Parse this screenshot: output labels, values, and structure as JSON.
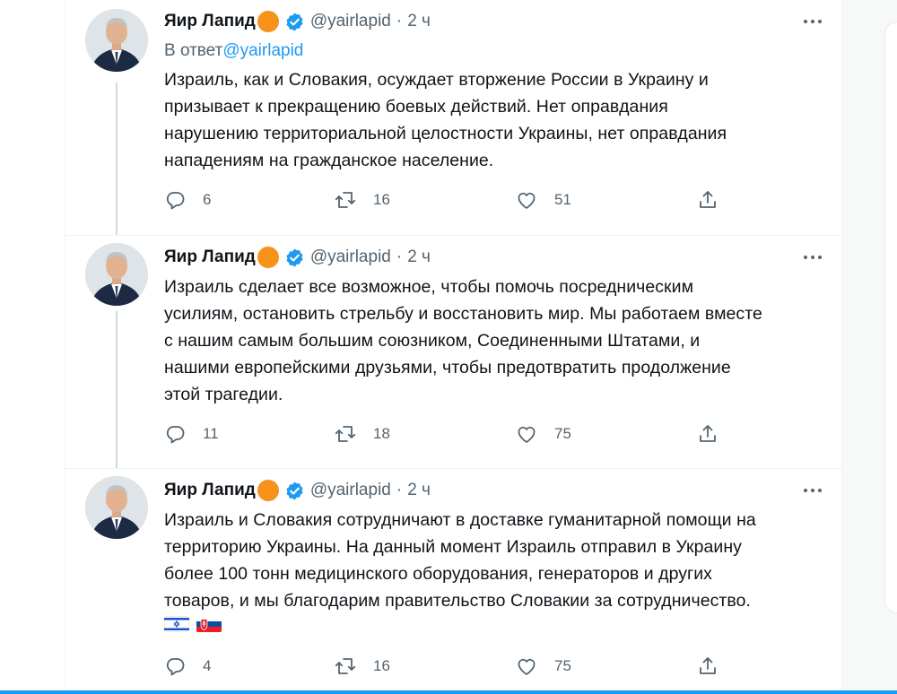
{
  "tweets": [
    {
      "author_name": "Яир Лапид",
      "handle": "@yairlapid",
      "separator": "·",
      "time": "2 ч",
      "reply_prefix": "В ответ",
      "reply_handle": "@yairlapid",
      "text_lines": [
        "Израиль, как и Словакия, осуждает вторжение России в Украину и",
        "призывает к прекращению боевых действий. Нет оправдания",
        "нарушению территориальной целостности Украины, нет оправдания",
        "нападениям на гражданское население."
      ],
      "replies": "6",
      "retweets": "16",
      "likes": "51"
    },
    {
      "author_name": "Яир Лапид",
      "handle": "@yairlapid",
      "separator": "·",
      "time": "2 ч",
      "text_lines": [
        "Израиль сделает все возможное, чтобы помочь посредническим",
        "усилиям, остановить стрельбу и восстановить мир. Мы работаем вместе",
        "с нашим самым большим союзником, Соединенными Штатами, и",
        "нашими европейскими друзьями, чтобы предотвратить продолжение",
        "этой трагедии."
      ],
      "replies": "11",
      "retweets": "18",
      "likes": "75"
    },
    {
      "author_name": "Яир Лапид",
      "handle": "@yairlapid",
      "separator": "·",
      "time": "2 ч",
      "text_lines": [
        "Израиль и Словакия сотрудничают в доставке гуманитарной помощи на",
        "территорию Украины. На данный момент Израиль отправил в Украину",
        "более 100 тонн медицинского оборудования, генераторов и других",
        "товаров, и мы благодарим правительство Словакии за сотрудничество."
      ],
      "flags": [
        "israel-flag",
        "slovakia-flag"
      ],
      "replies": "4",
      "retweets": "16",
      "likes": "75"
    }
  ],
  "colors": {
    "accent": "#1d9bf0",
    "secondary_text": "#536471",
    "badge_orange": "#f7931a",
    "thread_line": "#cfd9de"
  },
  "icons": [
    "reply-icon",
    "retweet-icon",
    "like-icon",
    "share-icon",
    "more-icon",
    "verified-badge-icon"
  ]
}
